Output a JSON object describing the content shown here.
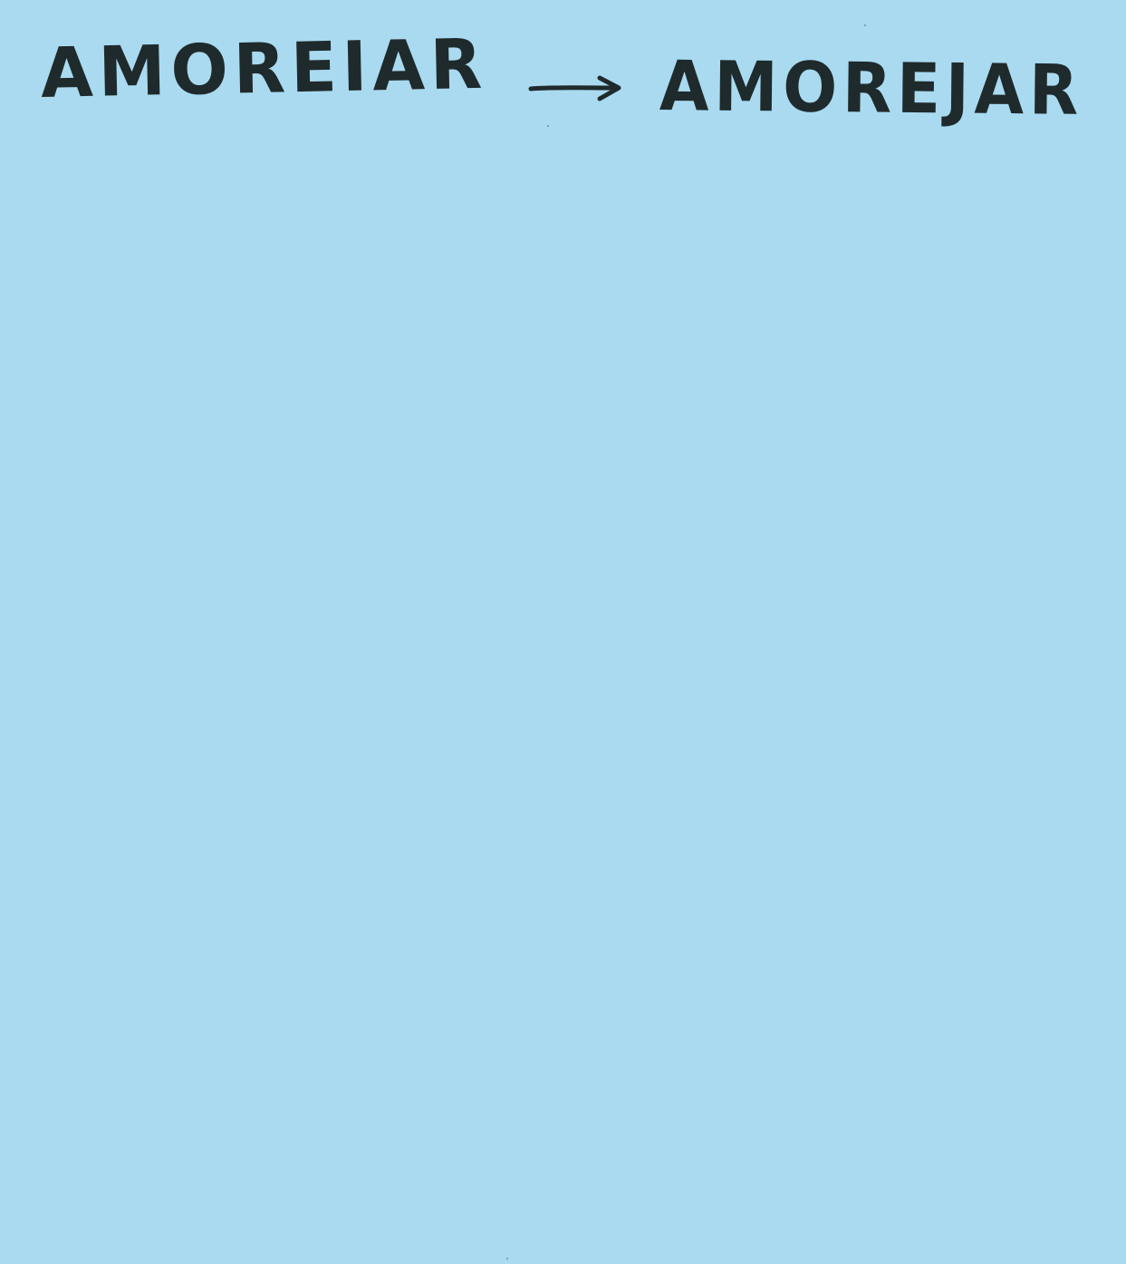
{
  "note": {
    "background_color": "#a9daf0",
    "ink_color": "#1f2a2c",
    "from_word": "AMOREIAR",
    "to_word": "AMOREJAR",
    "connector_icon": "right-arrow-icon"
  }
}
